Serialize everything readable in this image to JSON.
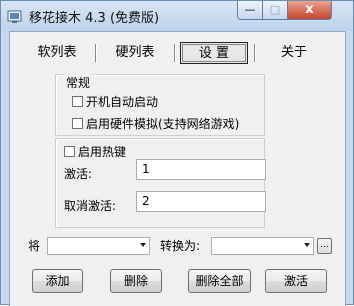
{
  "window": {
    "title": "移花接木 4.3 (免费版)",
    "caption": {
      "close": "x",
      "minimize": "—",
      "maximize": "□"
    }
  },
  "tabs": [
    {
      "label": "软列表",
      "selected": false
    },
    {
      "label": "硬列表",
      "selected": false
    },
    {
      "label": "设 置",
      "selected": true
    },
    {
      "label": "关于",
      "selected": false
    }
  ],
  "settings": {
    "general_group": "常规",
    "autostart_label": "开机自动启动",
    "autostart_checked": false,
    "hardware_label": "启用硬件模拟(支持网络游戏)",
    "hardware_checked": false,
    "hotkey_label": "启用热键",
    "hotkey_checked": false,
    "activate_label": "激活:",
    "activate_value": "1",
    "deactivate_label": "取消激活:",
    "deactivate_value": "2"
  },
  "mapping": {
    "from_label": "将",
    "from_value": "",
    "to_label": "转换为:",
    "to_value": "",
    "browse_label": "..."
  },
  "buttons": {
    "add": "添加",
    "delete": "删除",
    "delete_all": "删除全部",
    "activate": "激活"
  },
  "colors": {
    "frame": "#c4d9ee",
    "close_button": "#c7422c",
    "client_background": "#f0f0f0"
  }
}
